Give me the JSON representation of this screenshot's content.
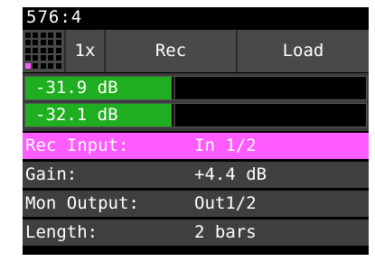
{
  "header": {
    "counter": "576:4"
  },
  "toolbar": {
    "grid_active_cell": "bottom-left",
    "speed_label": "1x",
    "rec_label": "Rec",
    "load_label": "Load"
  },
  "meters": [
    {
      "label": "-31.9 dB",
      "fill_fraction": 0.43
    },
    {
      "label": "-32.1 dB",
      "fill_fraction": 0.43
    }
  ],
  "params": [
    {
      "key": "Rec Input:",
      "value": "In 1/2",
      "selected": true
    },
    {
      "key": "Gain:",
      "value": "+4.4 dB",
      "selected": false
    },
    {
      "key": "Mon Output:",
      "value": "Out1/2",
      "selected": false
    },
    {
      "key": "Length:",
      "value": "2 bars",
      "selected": false
    }
  ],
  "colors": {
    "accent": "#ff5bff",
    "meter_green": "#1fae1f",
    "panel": "#494949",
    "row": "#3f3f3f"
  }
}
